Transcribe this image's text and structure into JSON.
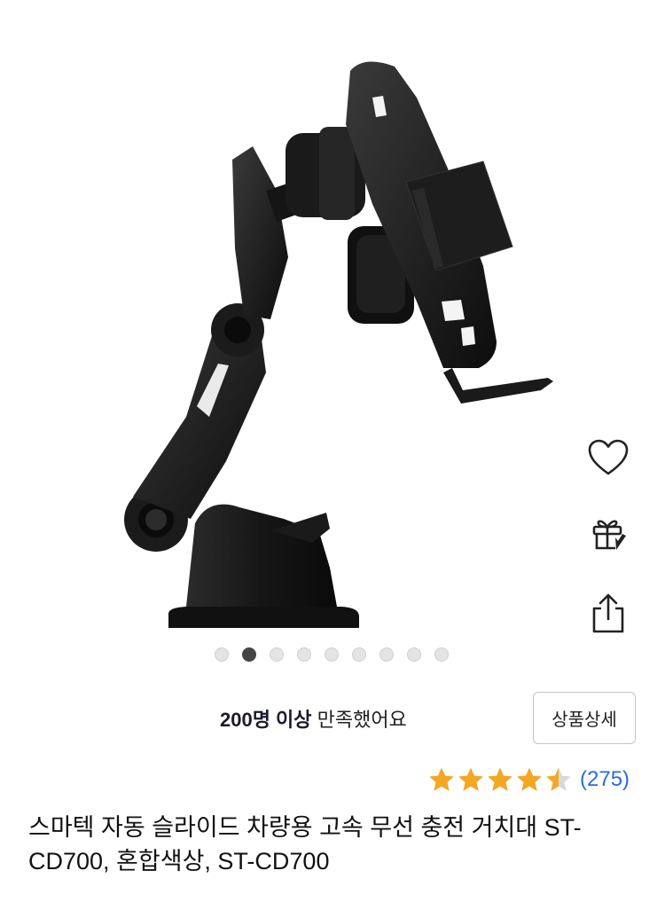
{
  "gallery": {
    "total_images": 9,
    "active_index": 2
  },
  "actions": {
    "wishlist_icon": "heart-icon",
    "gift_icon": "gift-icon",
    "share_icon": "share-icon"
  },
  "satisfaction": {
    "highlight": "200명 이상",
    "rest": " 만족했어요"
  },
  "detail_button_label": "상품상세",
  "rating": {
    "stars": 4.5,
    "count": "(275)",
    "star_color": "#f5a623"
  },
  "product": {
    "title": "스마텍 자동 슬라이드 차량용 고속 무선 충전 거치대 ST-CD700, 혼합색상, ST-CD700"
  }
}
